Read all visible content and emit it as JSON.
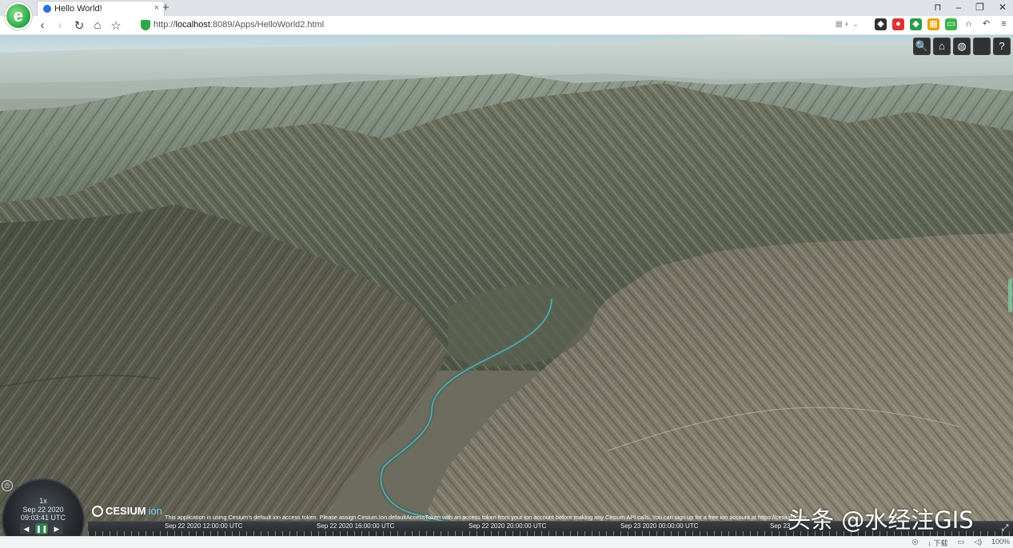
{
  "browser": {
    "logo_letter": "e",
    "tab_title": "Hello World!",
    "tab_close": "×",
    "new_tab": "+",
    "url_prefix": "http://",
    "url_host": "localhost",
    "url_rest": ":8089/Apps/HelloWorld2.html",
    "nav": {
      "back": "‹",
      "forward": "›",
      "reload": "↻",
      "home": "⌂",
      "star": "☆"
    }
  },
  "toolbar": [
    {
      "name": "geocoder-button",
      "glyph": "🔍"
    },
    {
      "name": "home-button",
      "glyph": "⌂"
    },
    {
      "name": "scene-mode-button",
      "glyph": "◍"
    },
    {
      "name": "base-layer-picker-button",
      "glyph": ""
    },
    {
      "name": "help-button",
      "glyph": "?"
    }
  ],
  "animation": {
    "speed": "1x",
    "date": "Sep 22 2020",
    "time": "09:03:41 UTC",
    "controls": {
      "reverse": "◀",
      "pause": "❚❚",
      "play": "▶"
    }
  },
  "cesium": {
    "brand": "CESIUM",
    "suffix": "ion"
  },
  "credit": "This application is using Cesium's default ion access token. Please assign Cesium.Ion.defaultAccessToken with an access token from your ion account before making any Cesium API calls. You can sign up for a free ion account at https://cesium.com",
  "timeline": {
    "labels": [
      "Sep 22 2020 12:00:00 UTC",
      "Sep 22 2020 16:00:00 UTC",
      "Sep 22 2020 20:00:00 UTC",
      "Sep 23 2020 00:00:00 UTC",
      "Sep 23"
    ]
  },
  "watermark": "头条 @水经注GIS",
  "status": {
    "download": "下载",
    "zoom": "100%"
  }
}
